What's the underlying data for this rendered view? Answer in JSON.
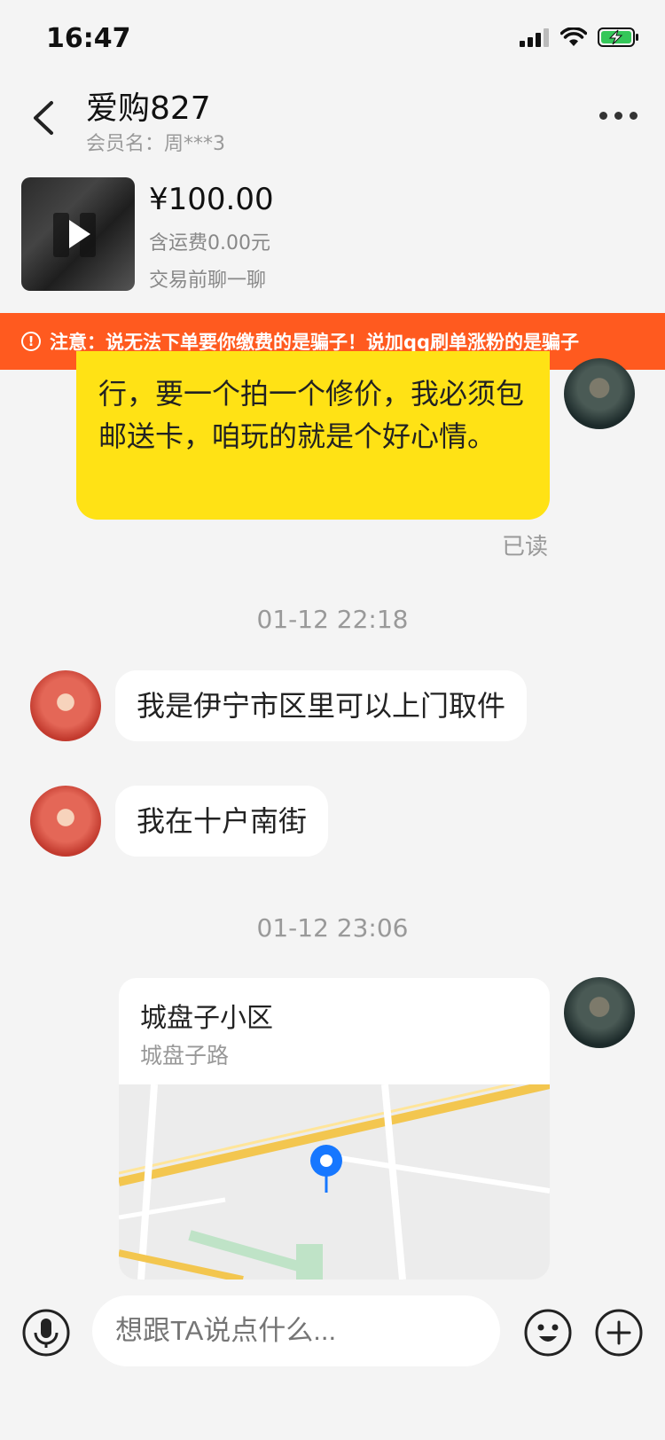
{
  "status_bar": {
    "time": "16:47"
  },
  "header": {
    "title": "爱购827",
    "member_label": "会员名：周***3"
  },
  "product": {
    "price": "¥100.00",
    "shipping": "含运费0.00元",
    "cta": "交易前聊一聊"
  },
  "warning": {
    "text": "注意：说无法下单要你缴费的是骗子！说加qq刷单涨粉的是骗子"
  },
  "messages": {
    "outgoing_text": "行，要一个拍一个修价，我必须包邮送卡，咱玩的就是个好心情。",
    "read_status": "已读",
    "timestamp_1": "01-12 22:18",
    "incoming_1": "我是伊宁市区里可以上门取件",
    "incoming_2": "我在十户南街",
    "timestamp_2": "01-12 23:06",
    "location": {
      "name": "城盘子小区",
      "address": "城盘子路"
    }
  },
  "composer": {
    "placeholder": "想跟TA说点什么..."
  },
  "colors": {
    "warning_bg": "#ff5a1f",
    "outgoing_bubble": "#ffe215",
    "map_pin": "#1677ff"
  }
}
